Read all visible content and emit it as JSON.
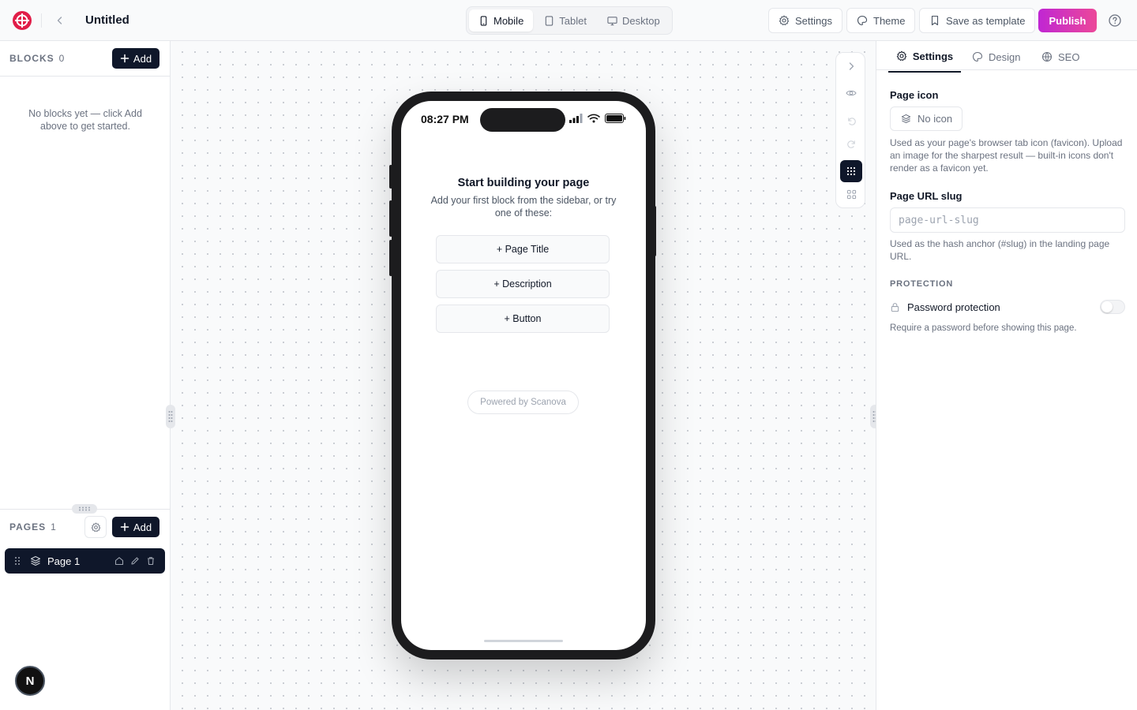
{
  "header": {
    "title": "Untitled",
    "devices": [
      {
        "label": "Mobile",
        "icon": "smartphone-icon",
        "active": true
      },
      {
        "label": "Tablet",
        "icon": "tablet-icon",
        "active": false
      },
      {
        "label": "Desktop",
        "icon": "monitor-icon",
        "active": false
      }
    ],
    "settings_label": "Settings",
    "theme_label": "Theme",
    "save_template_label": "Save as template",
    "publish_label": "Publish"
  },
  "blocks": {
    "heading": "BLOCKS",
    "count": "0",
    "add_label": "Add",
    "empty_text": "No blocks yet — click Add above to get started."
  },
  "pages": {
    "heading": "PAGES",
    "count": "1",
    "add_label": "Add",
    "items": [
      {
        "name": "Page 1",
        "active": true
      }
    ]
  },
  "avatar": {
    "initial": "N"
  },
  "preview": {
    "time": "08:27 PM",
    "heading": "Start building your page",
    "subtext": "Add your first block from the sidebar, or try one of these:",
    "suggestions": [
      "+ Page Title",
      "+ Description",
      "+ Button"
    ],
    "powered_by": "Powered by Scanova"
  },
  "right_panel": {
    "tabs": [
      {
        "label": "Settings",
        "icon": "gear-icon",
        "active": true
      },
      {
        "label": "Design",
        "icon": "palette-icon",
        "active": false
      },
      {
        "label": "SEO",
        "icon": "globe-icon",
        "active": false
      }
    ],
    "page_icon_label": "Page icon",
    "page_icon_value": "No icon",
    "page_icon_help": "Used as your page's browser tab icon (favicon). Upload an image for the sharpest result — built-in icons don't render as a favicon yet.",
    "slug_label": "Page URL slug",
    "slug_placeholder": "page-url-slug",
    "slug_help": "Used as the hash anchor (#slug) in the landing page URL.",
    "protection_heading": "PROTECTION",
    "password_label": "Password protection",
    "password_enabled": false,
    "password_help": "Require a password before showing this page."
  },
  "colors": {
    "brand_red": "#e11d48",
    "dark": "#0f172a",
    "publish_gradient_start": "#c026d3",
    "publish_gradient_end": "#ec4899"
  }
}
